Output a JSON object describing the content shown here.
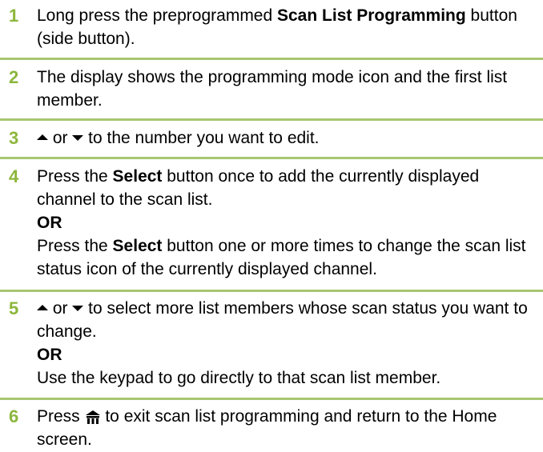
{
  "steps": [
    {
      "num": "1",
      "t1": "Long press the preprogrammed ",
      "b1": "Scan List Programming",
      "t2": " button (side button)."
    },
    {
      "num": "2",
      "t1": "The display shows the programming mode icon and the first list member."
    },
    {
      "num": "3",
      "or": " or ",
      "t1": " to the number you want to edit."
    },
    {
      "num": "4",
      "t1": "Press the ",
      "b1": "Select",
      "t2": " button once to add the currently displayed channel to the scan list.",
      "or_label": "OR",
      "t3": "Press the ",
      "b2": "Select",
      "t4": " button one or more times to change the scan list status icon of the currently displayed channel."
    },
    {
      "num": "5",
      "or": " or ",
      "t1": " to select more list members whose scan status you want to change.",
      "or_label": "OR",
      "t2": "Use the keypad to go directly to that scan list member."
    },
    {
      "num": "6",
      "t1": "Press ",
      "t2": " to exit scan list programming and return to the Home screen."
    }
  ],
  "icons": {
    "up": "up-arrow-icon",
    "down": "down-arrow-icon",
    "home": "home-icon"
  },
  "colors": {
    "step_number": "#8cb63c",
    "divider": "#a7c771"
  }
}
